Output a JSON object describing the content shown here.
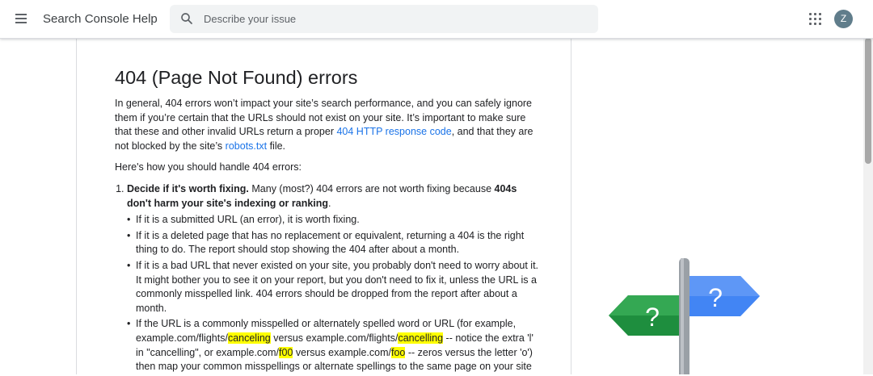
{
  "header": {
    "product_title": "Search Console Help",
    "search_placeholder": "Describe your issue",
    "avatar_letter": "Z",
    "icons": [
      "menu-icon",
      "search-icon",
      "apps-icon"
    ]
  },
  "article": {
    "title": "404 (Page Not Found) errors",
    "intro": {
      "t1": "In general, 404 errors won’t impact your site’s search performance, and you can safely ignore them if you’re certain that the URLs should not exist on your site. It’s important to make sure that these and other invalid URLs return a proper ",
      "link1": "404 HTTP response code",
      "t2": ", and that they are not blocked by the site’s ",
      "link2": "robots.txt",
      "t3": " file."
    },
    "handle_intro": "Here's how you should handle 404 errors:",
    "step1": {
      "bold": "Decide if it's worth fixing.",
      "t1": " Many (most?) 404 errors are not worth fixing because ",
      "bold2": "404s don't harm your site's indexing or ranking",
      "t2": "."
    },
    "bullets": {
      "b1": "If it is a submitted URL (an error), it is worth fixing.",
      "b2": "If it is a deleted page that has no replacement or equivalent, returning a 404 is the right thing to do. The report should stop showing the 404 after about a month.",
      "b3": "If it is a bad URL that never existed on your site, you probably don't need to worry about it. It might bother you to see it on your report, but you don't need to fix it, unless the URL is a commonly misspelled link. 404 errors should be dropped from the report after about a month.",
      "b4": {
        "t1": "If the URL is a commonly misspelled or alternately spelled word or URL (for example, example.com/flights/",
        "h1": "canceling",
        "t2": " versus example.com/flights/",
        "h2": "cancelling",
        "t3": " -- notice the extra 'l' in \"cancelling\", or example.com/",
        "h3": "f00",
        "t4": " versus example.com/",
        "h4": "foo",
        "t5": " -- zeros versus the letter 'o') then map your common misspellings or alternate spellings to the same page on your site"
      }
    }
  },
  "illustration": {
    "left_sign_text": "?",
    "right_sign_text": "?",
    "colors": {
      "green": "#1e8e3e",
      "blue": "#4285f4",
      "pole": "#9aa0a6"
    }
  }
}
